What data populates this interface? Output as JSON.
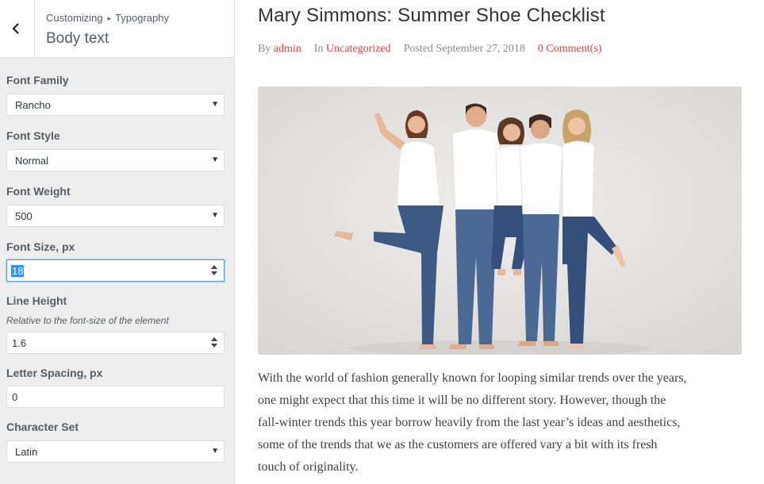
{
  "customizer": {
    "breadcrumb_parent": "Customizing",
    "breadcrumb_current": "Typography",
    "section_title": "Body text",
    "controls": {
      "font_family": {
        "label": "Font Family",
        "value": "Rancho"
      },
      "font_style": {
        "label": "Font Style",
        "value": "Normal"
      },
      "font_weight": {
        "label": "Font Weight",
        "value": "500"
      },
      "font_size": {
        "label": "Font Size, px",
        "value": "18"
      },
      "line_height": {
        "label": "Line Height",
        "description": "Relative to the font-size of the element",
        "value": "1.6"
      },
      "letter_spacing": {
        "label": "Letter Spacing, px",
        "value": "0"
      },
      "character_set": {
        "label": "Character Set",
        "value": "Latin"
      }
    }
  },
  "post": {
    "title": "Mary Simmons: Summer Shoe Checklist",
    "meta": {
      "by_prefix": "By",
      "author": "admin",
      "in_prefix": "In",
      "category": "Uncategorized",
      "posted": "Posted September 27, 2018",
      "comments": "0 Comment(s)"
    },
    "body_lines": [
      "With the world of fashion generally known for looping similar trends over the years,",
      "one might expect that this time it will be no different story. However, though the",
      "fall-winter trends this year borrow heavily from the last year’s ideas and aesthetics,",
      "some of the trends that we as the customers are offered vary a bit with its fresh",
      "touch of originality."
    ]
  },
  "icons": {
    "back": "chevron-left-icon",
    "dropdown": "dropdown-arrow-icon",
    "spinner": "number-spinner-icon"
  },
  "colors": {
    "link_red": "#e53e3e",
    "focus_blue": "#5b9dd9",
    "selection_blue": "#3390ff",
    "sidebar_bg": "#eeeeee"
  }
}
